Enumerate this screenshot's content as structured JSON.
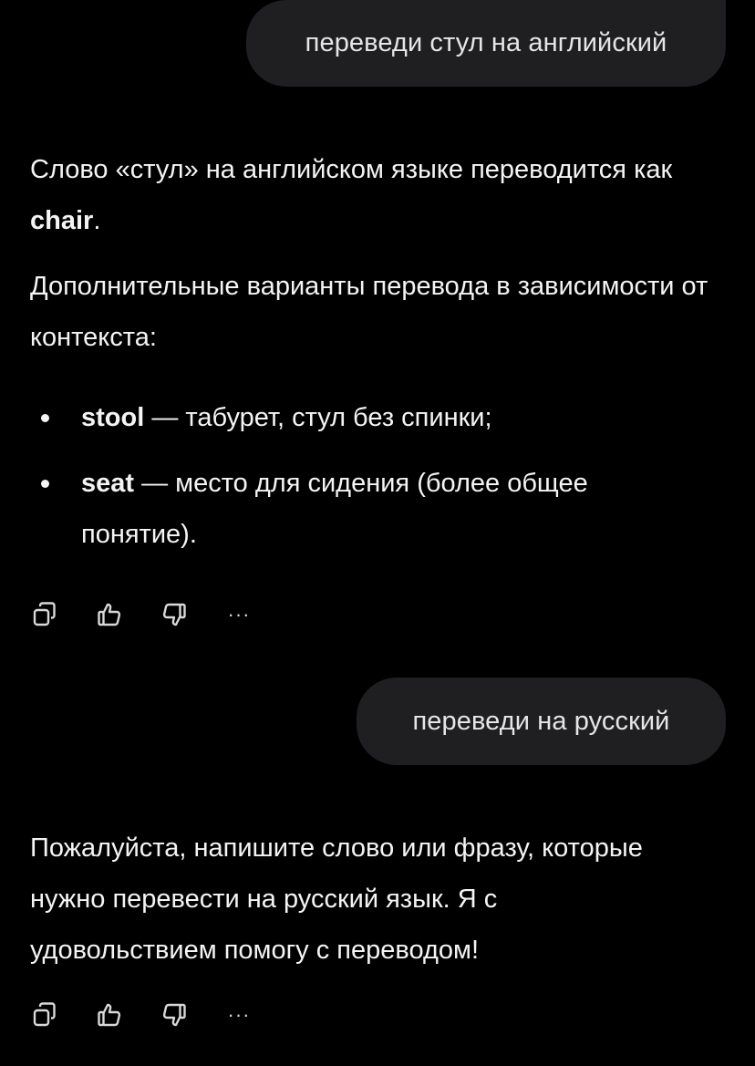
{
  "conversation": {
    "message1": {
      "text": "переведи стул на английский"
    },
    "answer1": {
      "p1_pre": "Слово «стул» на английском языке переводится как ",
      "p1_bold": "chair",
      "p1_post": ".",
      "p2": "Дополнительные варианты перевода в зависимости от контекста:",
      "items": [
        {
          "term": "stool",
          "desc": " — табурет, стул без спинки;"
        },
        {
          "term": "seat",
          "desc": " — место для сидения (более общее понятие)."
        }
      ]
    },
    "message2": {
      "text": "переведи на русский"
    },
    "answer2": {
      "text": "Пожалуйста, напишите слово или фразу, которые нужно перевести на русский язык. Я с удовольствием помогу с переводом!"
    },
    "actions": {
      "copy_icon": "copy-icon",
      "like_icon": "thumbs-up-icon",
      "dislike_icon": "thumbs-down-icon",
      "more_label": "···"
    }
  },
  "colors": {
    "background": "#000000",
    "user_bubble": "#1f1f21",
    "text": "#f4f4f4"
  }
}
